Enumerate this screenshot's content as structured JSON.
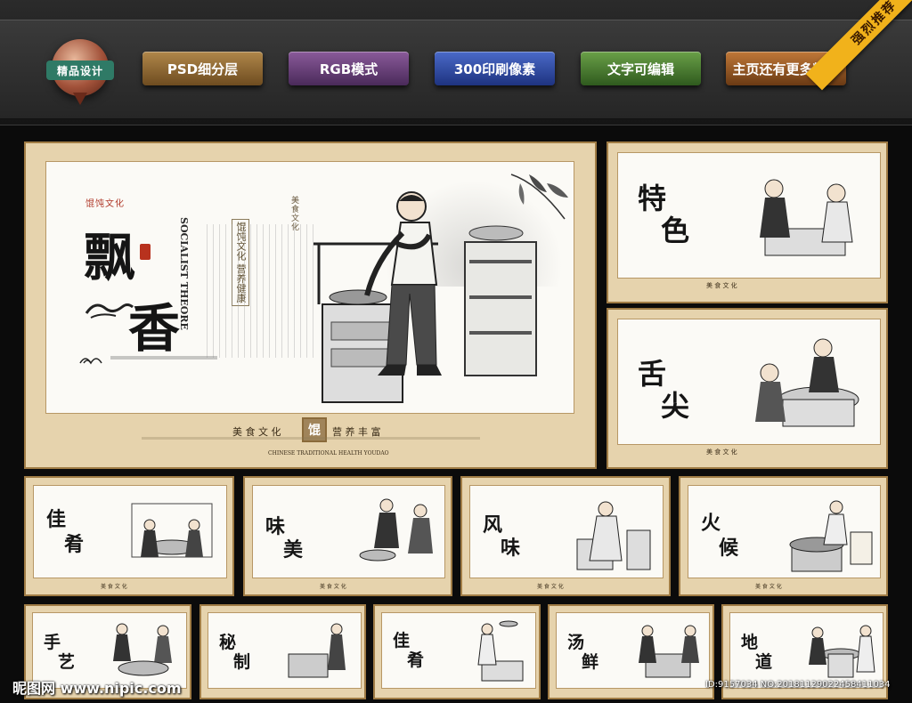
{
  "header": {
    "logo_label": "精品设计",
    "buttons": [
      "PSD细分层",
      "RGB模式",
      "300印刷像素",
      "文字可编辑",
      "主页还有更多精彩"
    ],
    "corner_ribbon": "强烈推荐"
  },
  "main_panel": {
    "title_1": "飘",
    "title_2": "香",
    "culture_tag": "馄饨文化",
    "vertical_en": "SOCIALIST THEORE",
    "vertical_badge": "馄饨文化 营养健康",
    "small_caption": "美食文化",
    "footer_left": "美 食 文 化",
    "footer_badge": "馄",
    "footer_right": "营 养 丰 富",
    "footer_en": "CHINESE TRADITIONAL HEALTH YOUDAO"
  },
  "right_panels": [
    {
      "t1": "特",
      "t2": "色"
    },
    {
      "t1": "舌",
      "t2": "尖"
    }
  ],
  "row2_panels": [
    {
      "t1": "佳",
      "t2": "肴"
    },
    {
      "t1": "味",
      "t2": "美"
    },
    {
      "t1": "风",
      "t2": "味"
    },
    {
      "t1": "火",
      "t2": "候"
    }
  ],
  "row3_panels": [
    {
      "t1": "手",
      "t2": "艺"
    },
    {
      "t1": "秘",
      "t2": "制"
    },
    {
      "t1": "佳",
      "t2": "肴"
    },
    {
      "t1": "汤",
      "t2": "鲜"
    },
    {
      "t1": "地",
      "t2": "道"
    }
  ],
  "panel_footer": "美 食 文 化",
  "watermark_left": "昵图网 www.nipic.com",
  "watermark_right": "ID:9157034 NO:20181129022458411034"
}
